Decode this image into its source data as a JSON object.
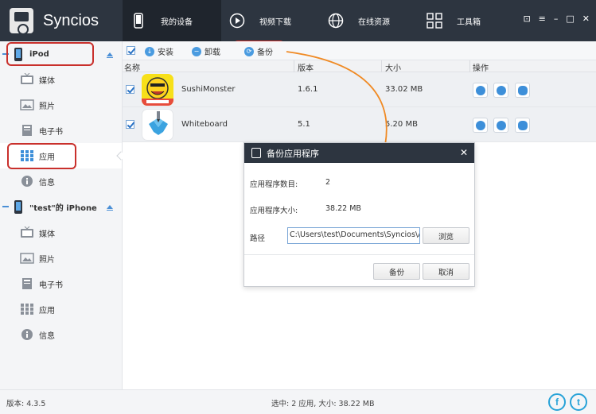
{
  "app": {
    "name": "Syncios"
  },
  "nav": {
    "items": [
      {
        "label": "我的设备",
        "icon": "phone-icon"
      },
      {
        "label": "视频下载",
        "icon": "play-icon"
      },
      {
        "label": "在线资源",
        "icon": "globe-icon"
      },
      {
        "label": "工具箱",
        "icon": "grid-icon"
      }
    ]
  },
  "window_controls": {
    "skin": "⊡",
    "menu": "≡",
    "minimize": "–",
    "maximize": "□",
    "close": "✕"
  },
  "sidebar": {
    "device1": {
      "name": "iPod",
      "items": [
        {
          "label": "媒体",
          "icon": "media-icon"
        },
        {
          "label": "照片",
          "icon": "photo-icon"
        },
        {
          "label": "电子书",
          "icon": "ebook-icon"
        },
        {
          "label": "应用",
          "icon": "apps-icon"
        },
        {
          "label": "信息",
          "icon": "info-icon"
        }
      ]
    },
    "device2": {
      "name": "\"test\"的 iPhone",
      "items": [
        {
          "label": "媒体",
          "icon": "media-icon"
        },
        {
          "label": "照片",
          "icon": "photo-icon"
        },
        {
          "label": "电子书",
          "icon": "ebook-icon"
        },
        {
          "label": "应用",
          "icon": "apps-icon"
        },
        {
          "label": "信息",
          "icon": "info-icon"
        }
      ]
    }
  },
  "toolbar": {
    "install": "安装",
    "uninstall": "卸载",
    "backup": "备份"
  },
  "table": {
    "columns": [
      "名称",
      "版本",
      "大小",
      "操作"
    ],
    "rows": [
      {
        "name": "SushiMonster",
        "version": "1.6.1",
        "size": "33.02 MB",
        "checked": true
      },
      {
        "name": "Whiteboard",
        "version": "5.1",
        "size": "5.20 MB",
        "checked": true
      }
    ]
  },
  "dialog": {
    "title": "备份应用程序",
    "count_label": "应用程序数目:",
    "count_value": "2",
    "size_label": "应用程序大小:",
    "size_value": "38.22 MB",
    "path_label": "路径",
    "path_value": "C:\\Users\\test\\Documents\\Syncios\\App",
    "browse": "浏览",
    "backup": "备份",
    "cancel": "取消",
    "close": "✕"
  },
  "status": {
    "version": "版本: 4.3.5",
    "selection": "选中: 2 应用, 大小: 38.22 MB",
    "facebook": "f",
    "twitter": "t"
  },
  "colors": {
    "topbar": "#2d3540",
    "accent": "#4a9be0",
    "highlight": "#c9302c",
    "arrow": "#f08a24"
  }
}
